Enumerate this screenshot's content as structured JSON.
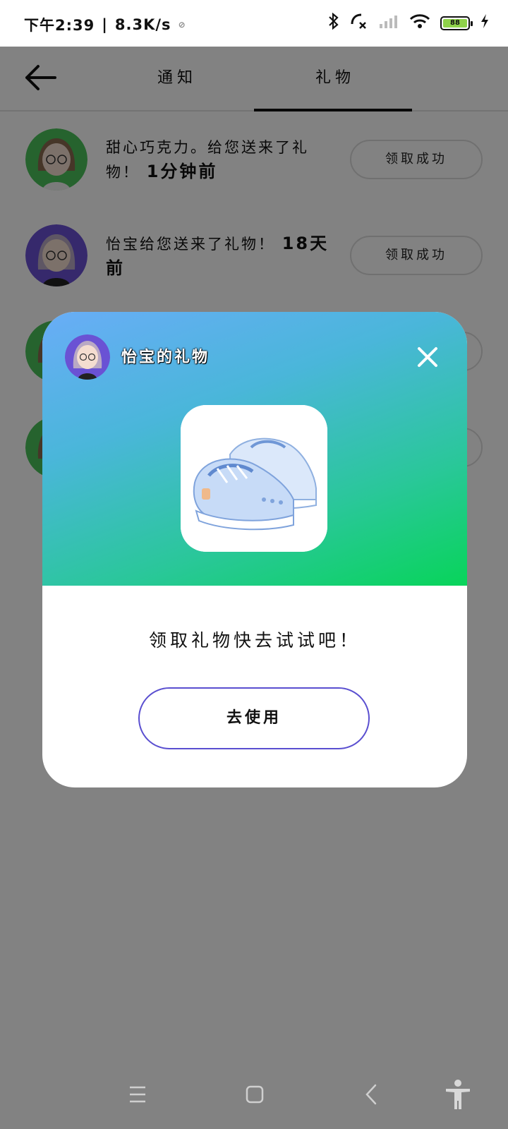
{
  "status_bar": {
    "time": "下午2:39",
    "net_speed": "8.3K/s",
    "battery_level": "88"
  },
  "header": {
    "tabs": [
      {
        "label": "通知",
        "active": false
      },
      {
        "label": "礼物",
        "active": true
      }
    ]
  },
  "gift_list": [
    {
      "text": "甜心巧克力。给您送来了礼物！",
      "time": "1分钟前",
      "button_label": "领取成功",
      "avatar_bg": "#4cc25a"
    },
    {
      "text": "怡宝给您送来了礼物！",
      "time": "18天前",
      "button_label": "领取成功",
      "avatar_bg": "#6a52d4"
    },
    {
      "text": "",
      "time": "",
      "button_label": "",
      "avatar_bg": "#4cc25a"
    },
    {
      "text": "",
      "time": "",
      "button_label": "",
      "avatar_bg": "#4cc25a"
    }
  ],
  "modal": {
    "title": "怡宝的礼物",
    "message": "领取礼物快去试试吧！",
    "use_button_label": "去使用",
    "gift_icon": "sneakers-icon",
    "colors": {
      "gradient_start": "#69adf7",
      "gradient_end": "#08d45a",
      "button_border": "#5a4fd0"
    }
  },
  "nav_bar": {
    "icons": [
      "menu-icon",
      "home-icon",
      "back-icon",
      "accessibility-icon"
    ]
  }
}
